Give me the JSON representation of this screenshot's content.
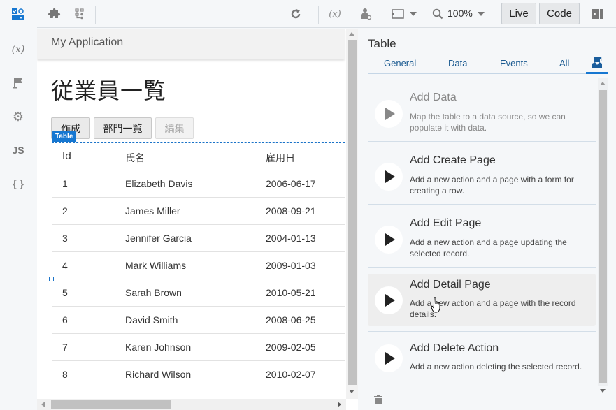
{
  "rail": {
    "items": [
      {
        "name": "components",
        "icon": "components-icon"
      },
      {
        "name": "variables",
        "icon": "variable-icon",
        "label": "(x)"
      },
      {
        "name": "flags",
        "icon": "flag-icon"
      },
      {
        "name": "settings",
        "icon": "gear-icon"
      },
      {
        "name": "javascript",
        "icon": "js-icon",
        "label": "JS"
      },
      {
        "name": "json",
        "icon": "braces-icon",
        "label": "{ }"
      }
    ]
  },
  "toolbar": {
    "zoom": "100%",
    "live_label": "Live",
    "code_label": "Code"
  },
  "canvas": {
    "app_title": "My Application",
    "page_title": "従業員一覧",
    "buttons": {
      "create": "作成",
      "departments": "部門一覧",
      "edit": "編集"
    },
    "table_tag": "Table",
    "table": {
      "headers": [
        "Id",
        "氏名",
        "雇用日"
      ],
      "rows": [
        [
          "1",
          "Elizabeth Davis",
          "2006-06-17"
        ],
        [
          "2",
          "James Miller",
          "2008-09-21"
        ],
        [
          "3",
          "Jennifer Garcia",
          "2004-01-13"
        ],
        [
          "4",
          "Mark Williams",
          "2009-01-03"
        ],
        [
          "5",
          "Sarah Brown",
          "2010-05-21"
        ],
        [
          "6",
          "David Smith",
          "2008-06-25"
        ],
        [
          "7",
          "Karen Johnson",
          "2009-02-05"
        ],
        [
          "8",
          "Richard Wilson",
          "2010-02-07"
        ]
      ]
    }
  },
  "panel": {
    "title": "Table",
    "tabs": [
      "General",
      "Data",
      "Events",
      "All"
    ],
    "active_tab_icon": "quick-start-icon",
    "actions": [
      {
        "title": "Add Data",
        "desc": "Map the table to a data source, so we can populate it with data.",
        "state": "muted"
      },
      {
        "title": "Add Create Page",
        "desc": "Add a new action and a page with a form for creating a row.",
        "state": "normal"
      },
      {
        "title": "Add Edit Page",
        "desc": "Add a new action and a page updating the selected record.",
        "state": "normal"
      },
      {
        "title": "Add Detail Page",
        "desc": "Add a new action and a page with the record details.",
        "state": "hover"
      },
      {
        "title": "Add Delete Action",
        "desc": "Add a new action deleting the selected record.",
        "state": "normal"
      }
    ]
  }
}
